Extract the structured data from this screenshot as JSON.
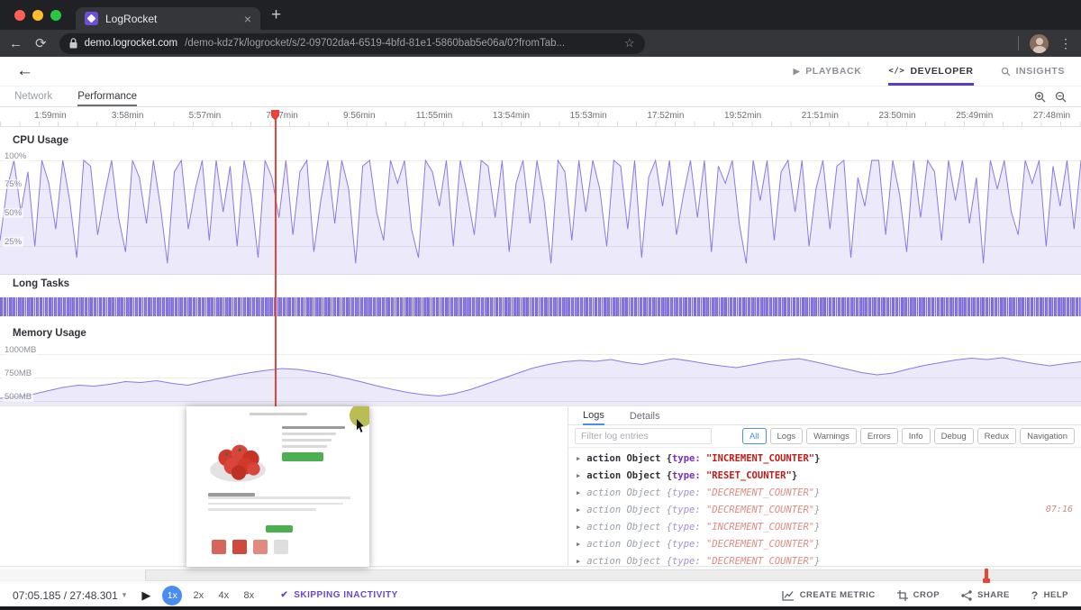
{
  "colors": {
    "accent_purple": "#5b3cc4",
    "chart_purple": "#8a79e8",
    "playhead_red": "#e8443a",
    "selected_blue": "#4a8df0",
    "log_key": "#7b2fbe",
    "log_value": "#c41a16"
  },
  "browser": {
    "tab_title": "LogRocket",
    "url_host": "demo.logrocket.com",
    "url_path": "/demo-kdz7k/logrocket/s/2-09702da4-6519-4bfd-81e1-5860bab5e06a/0?fromTab..."
  },
  "icons": {
    "back_browser": "←",
    "reload": "⟳",
    "star": "☆",
    "kebab": "⋮",
    "plus": "+",
    "close": "×",
    "back_app": "←",
    "play_nav": "▶",
    "dev": "</>",
    "caret": "▾",
    "play": "▶",
    "check": "✔",
    "help": "?",
    "expand": "▶"
  },
  "header": {
    "nav": [
      {
        "label": "PLAYBACK"
      },
      {
        "label": "DEVELOPER"
      },
      {
        "label": "INSIGHTS"
      }
    ]
  },
  "tabs": {
    "network": "Network",
    "performance": "Performance"
  },
  "timeline": {
    "ticks": [
      "1:59min",
      "3:58min",
      "5:57min",
      "7:57min",
      "9:56min",
      "11:55min",
      "13:54min",
      "15:53min",
      "17:52min",
      "19:52min",
      "21:51min",
      "23:50min",
      "25:49min",
      "27:48min"
    ]
  },
  "chart_data": [
    {
      "type": "area",
      "title": "CPU Usage",
      "ylabel_ticks": [
        "100%",
        "75%",
        "50%",
        "25%"
      ],
      "ylim": [
        0,
        100
      ],
      "unit": "%",
      "values": [
        30,
        75,
        100,
        55,
        90,
        25,
        100,
        80,
        40,
        100,
        65,
        15,
        100,
        95,
        35,
        70,
        100,
        50,
        20,
        100,
        85,
        45,
        100,
        60,
        10,
        90,
        100,
        40,
        75,
        100,
        30,
        100,
        55,
        95,
        25,
        100,
        70,
        15,
        100,
        85,
        50,
        100,
        35,
        90,
        100,
        20,
        65,
        100,
        45,
        100,
        75,
        10,
        95,
        100,
        55,
        30,
        100,
        80,
        100,
        40,
        15,
        100,
        90,
        60,
        100,
        25,
        100,
        70,
        35,
        100,
        95,
        50,
        100,
        20,
        80,
        100,
        45,
        100,
        65,
        10,
        100,
        90,
        30,
        100,
        55,
        100,
        75,
        25,
        100,
        95,
        40,
        100,
        15,
        85,
        100,
        60,
        100,
        35,
        70,
        100,
        50,
        100,
        20,
        95,
        80,
        100,
        45,
        10,
        100,
        65,
        100,
        30,
        90,
        100,
        55,
        100,
        25,
        75,
        100,
        40,
        95,
        100,
        15,
        85,
        60,
        100,
        100,
        35,
        100,
        70,
        20,
        100,
        50,
        100,
        90,
        30,
        100,
        65,
        100,
        45,
        85,
        10,
        100,
        75,
        100,
        55,
        35,
        100,
        80,
        100,
        25,
        95,
        60,
        100,
        40,
        100
      ]
    },
    {
      "type": "area",
      "title": "Memory Usage",
      "ylabel_ticks": [
        "1000MB",
        "750MB",
        "500MB"
      ],
      "ylim": [
        500,
        1000
      ],
      "unit": "MB",
      "values": [
        510,
        525,
        550,
        590,
        630,
        655,
        645,
        665,
        695,
        685,
        705,
        675,
        655,
        695,
        730,
        765,
        795,
        820,
        840,
        830,
        805,
        775,
        735,
        695,
        650,
        610,
        575,
        550,
        535,
        560,
        605,
        665,
        725,
        785,
        845,
        885,
        915,
        930,
        920,
        940,
        905,
        885,
        920,
        950,
        925,
        895,
        870,
        850,
        880,
        915,
        935,
        950,
        915,
        875,
        835,
        795,
        770,
        790,
        835,
        875,
        905,
        935,
        955,
        940,
        960,
        925,
        895,
        870,
        895,
        915
      ]
    }
  ],
  "long_tasks": {
    "title": "Long Tasks"
  },
  "logs": {
    "tab_logs": "Logs",
    "tab_details": "Details",
    "filter_placeholder": "Filter log entries",
    "filter_buttons": [
      "All",
      "Logs",
      "Warnings",
      "Errors",
      "Info",
      "Debug",
      "Redux",
      "Navigation"
    ],
    "active_filter": "All",
    "row_prefix": "action Object {",
    "row_key": "type:",
    "row_suffix": "}",
    "entries": [
      {
        "value": "\"INCREMENT_COUNTER\"",
        "muted": false,
        "time": ""
      },
      {
        "value": "\"RESET_COUNTER\"",
        "muted": false,
        "time": ""
      },
      {
        "value": "\"DECREMENT_COUNTER\"",
        "muted": true,
        "time": ""
      },
      {
        "value": "\"DECREMENT_COUNTER\"",
        "muted": true,
        "time": "07:16"
      },
      {
        "value": "\"INCREMENT_COUNTER\"",
        "muted": true,
        "time": ""
      },
      {
        "value": "\"DECREMENT_COUNTER\"",
        "muted": true,
        "time": ""
      },
      {
        "value": "\"DECREMENT_COUNTER\"",
        "muted": true,
        "time": ""
      }
    ]
  },
  "controls": {
    "time_display": "07:05.185 / 27:48.301",
    "speeds": [
      "1x",
      "2x",
      "4x",
      "8x"
    ],
    "active_speed": "1x",
    "skipping_label": "SKIPPING INACTIVITY",
    "actions": [
      {
        "label": "CREATE METRIC"
      },
      {
        "label": "CROP"
      },
      {
        "label": "SHARE"
      },
      {
        "label": "HELP"
      }
    ]
  }
}
